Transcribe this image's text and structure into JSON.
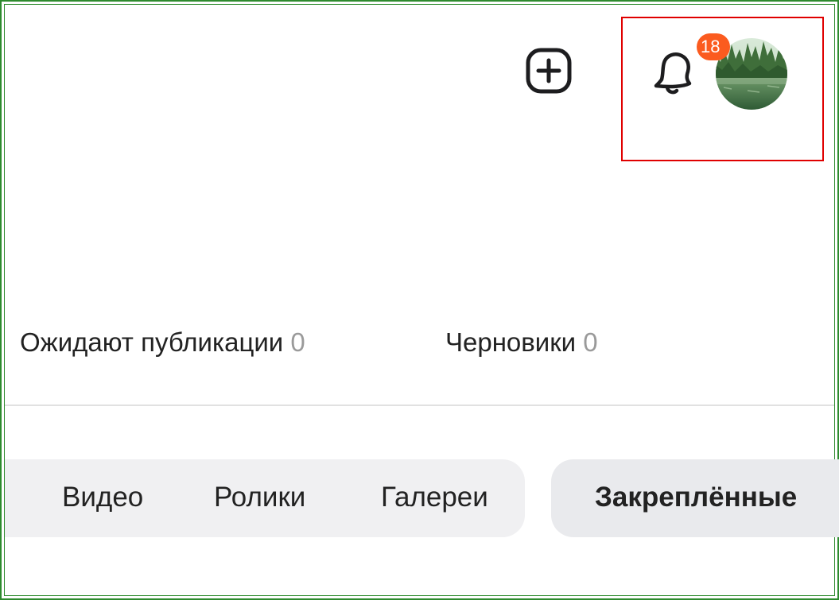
{
  "header": {
    "add_icon": "plus-square-icon",
    "bell_icon": "bell-icon",
    "notifications_count": "18",
    "badge_color": "#fb5b1f",
    "avatar": "forest-lake-avatar"
  },
  "status": {
    "pending_label": "Ожидают публикации",
    "pending_count": "0",
    "drafts_label": "Черновики",
    "drafts_count": "0"
  },
  "tabs": [
    {
      "label": "Видео"
    },
    {
      "label": "Ролики"
    },
    {
      "label": "Галереи"
    }
  ],
  "pinned_label": "Закреплённые",
  "colors": {
    "frame": "#2e8b2e",
    "highlight": "#e00000",
    "tabs_bg": "#f0f0f2",
    "count_gray": "#9a9a9a"
  }
}
